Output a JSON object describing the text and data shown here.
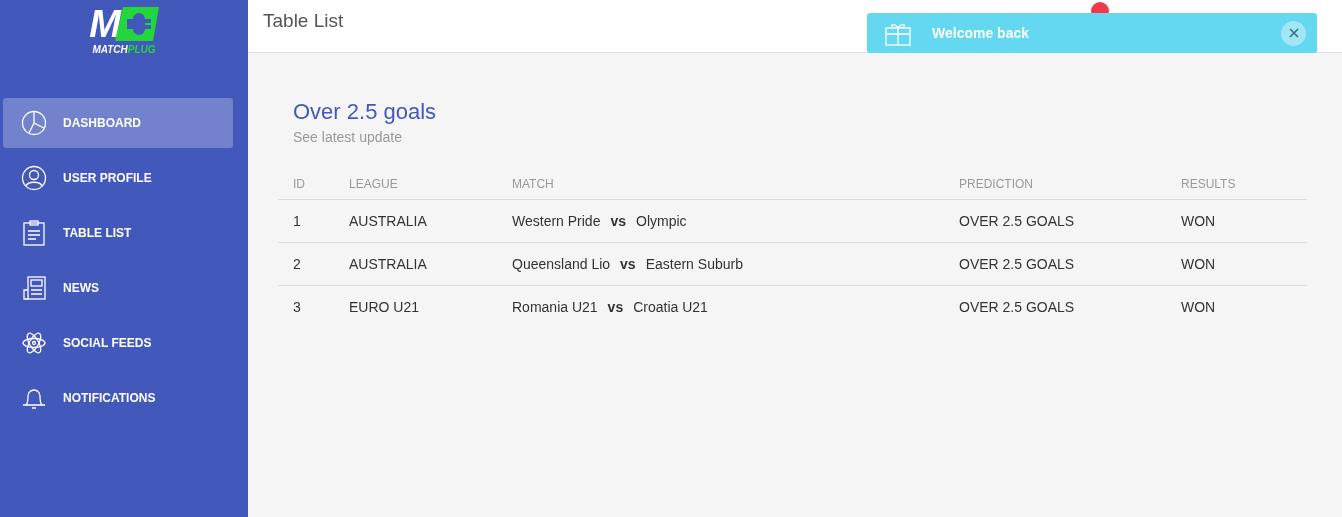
{
  "logo": {
    "mark": "M",
    "name_first": "MATCH",
    "name_second": "PLUG"
  },
  "sidebar": {
    "items": [
      {
        "label": "DASHBOARD",
        "selected": true
      },
      {
        "label": "USER PROFILE",
        "selected": false
      },
      {
        "label": "TABLE LIST",
        "selected": false
      },
      {
        "label": "NEWS",
        "selected": false
      },
      {
        "label": "SOCIAL FEEDS",
        "selected": false
      },
      {
        "label": "NOTIFICATIONS",
        "selected": false
      }
    ]
  },
  "header": {
    "title": "Table List"
  },
  "toast": {
    "message": "Welcome back"
  },
  "card": {
    "title": "Over 2.5 goals",
    "subtitle": "See latest update"
  },
  "table": {
    "columns": [
      "ID",
      "LEAGUE",
      "MATCH",
      "PREDICTION",
      "RESULTS"
    ],
    "rows": [
      {
        "id": "1",
        "league": "AUSTRALIA",
        "home": "Western Pride",
        "vs": "vs",
        "away": "Olympic",
        "prediction": "OVER 2.5 GOALS",
        "result": "WON"
      },
      {
        "id": "2",
        "league": "AUSTRALIA",
        "home": "Queensland Lio",
        "vs": "vs",
        "away": "Eastern Suburb",
        "prediction": "OVER 2.5 GOALS",
        "result": "WON"
      },
      {
        "id": "3",
        "league": "EURO U21",
        "home": "Romania U21",
        "vs": "vs",
        "away": "Croatia U21",
        "prediction": "OVER 2.5 GOALS",
        "result": "WON"
      }
    ]
  }
}
